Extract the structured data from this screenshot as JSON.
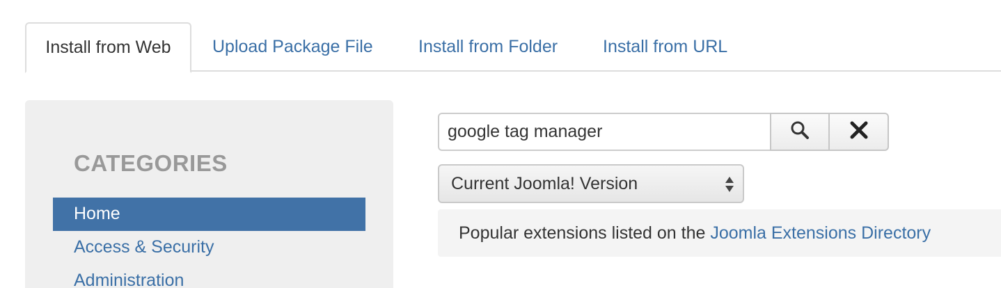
{
  "tabs": [
    {
      "label": "Install from Web",
      "active": true
    },
    {
      "label": "Upload Package File",
      "active": false
    },
    {
      "label": "Install from Folder",
      "active": false
    },
    {
      "label": "Install from URL",
      "active": false
    }
  ],
  "sidebar": {
    "title": "CATEGORIES",
    "items": [
      {
        "label": "Home",
        "active": true
      },
      {
        "label": "Access & Security",
        "active": false
      },
      {
        "label": "Administration",
        "active": false
      }
    ]
  },
  "search": {
    "value": "google tag manager",
    "search_icon": "magnifier-icon",
    "clear_icon": "close-icon"
  },
  "version_select": {
    "selected": "Current Joomla! Version",
    "icon": "updown-arrows-icon"
  },
  "info": {
    "text": "Popular extensions listed on the ",
    "link": "Joomla Extensions Directory"
  },
  "colors": {
    "link": "#3a6fa6",
    "active_item_bg": "#4172a7",
    "sidebar_bg": "#efefef"
  }
}
